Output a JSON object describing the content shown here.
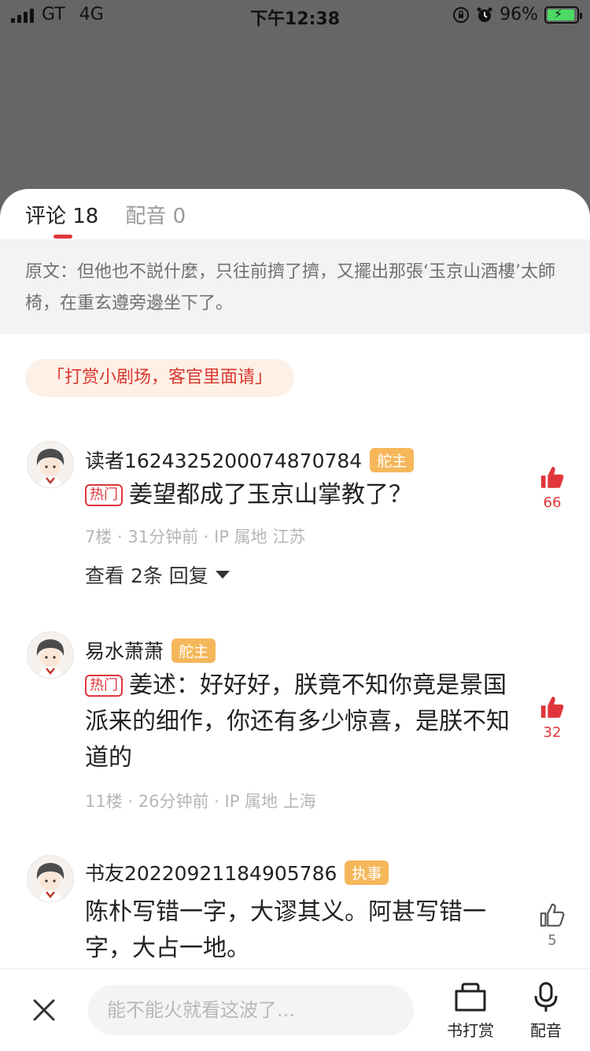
{
  "status_bar": {
    "carrier": "GT",
    "network": "4G",
    "time": "下午12:38",
    "battery_percent": "96%",
    "icons": [
      "signal-icon",
      "orientation-lock-icon",
      "alarm-icon",
      "battery-charging-icon"
    ]
  },
  "tabs": [
    {
      "label": "评论 18",
      "active": true
    },
    {
      "label": "配音 0",
      "active": false
    }
  ],
  "origin_text": "原文：但他也不説什麼，只往前擠了擠，又擺出那張‘玉京山酒樓’太師椅，在重玄遵旁邊坐下了。",
  "reward_chip": "「打赏小剧场，客官里面请」",
  "comments": [
    {
      "user": "读者1624325200074870784",
      "badge": "舵主",
      "hot_tag": "热门",
      "text": "姜望都成了玉京山掌教了？",
      "meta": "7楼 · 31分钟前 · IP 属地 江苏",
      "replies": "查看 2条 回复",
      "likes": "66",
      "liked": true
    },
    {
      "user": "易水萧萧",
      "badge": "舵主",
      "hot_tag": "热门",
      "text": "姜述：好好好，朕竟不知你竟是景国派来的细作，你还有多少惊喜，是朕不知道的",
      "meta": "11楼 · 26分钟前 · IP 属地 上海",
      "likes": "32",
      "liked": true
    },
    {
      "user": "书友20220921184905786",
      "badge": "执事",
      "text": "陈朴写错一字，大谬其义。阿甚写错一字，大占一地。",
      "likes": "5",
      "liked": false
    }
  ],
  "bottom_bar": {
    "input_placeholder": "能不能火就看这波了...",
    "reward_label": "书打赏",
    "dub_label": "配音"
  },
  "colors": {
    "accent_red": "#e0363b",
    "badge_orange": "#f5b75a",
    "dim_background": "#666666"
  }
}
